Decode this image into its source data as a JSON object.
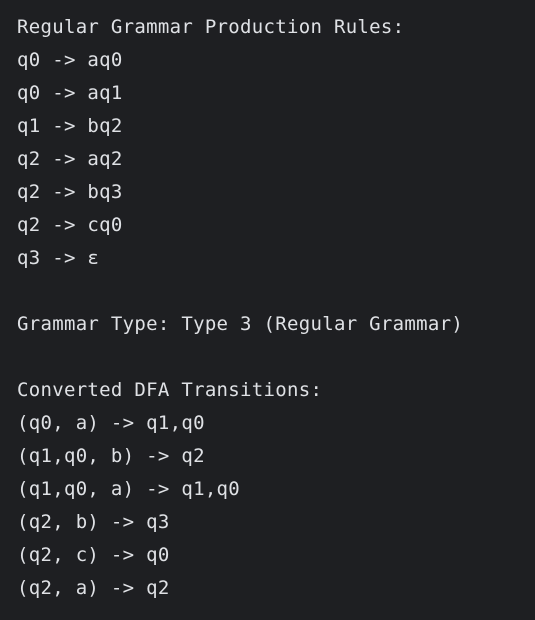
{
  "output": {
    "grammar_header": "Regular Grammar Production Rules:",
    "rules": [
      "q0 -> aq0",
      "q0 -> aq1",
      "q1 -> bq2",
      "q2 -> aq2",
      "q2 -> bq3",
      "q2 -> cq0",
      "q3 -> ε"
    ],
    "grammar_type": "Grammar Type: Type 3 (Regular Grammar)",
    "dfa_header": "Converted DFA Transitions:",
    "transitions": [
      "(q0, a) -> q1,q0",
      "(q1,q0, b) -> q2",
      "(q1,q0, a) -> q1,q0",
      "(q2, b) -> q3",
      "(q2, c) -> q0",
      "(q2, a) -> q2"
    ]
  },
  "colors": {
    "background": "#1e1f22",
    "text": "#dfe1e5"
  }
}
